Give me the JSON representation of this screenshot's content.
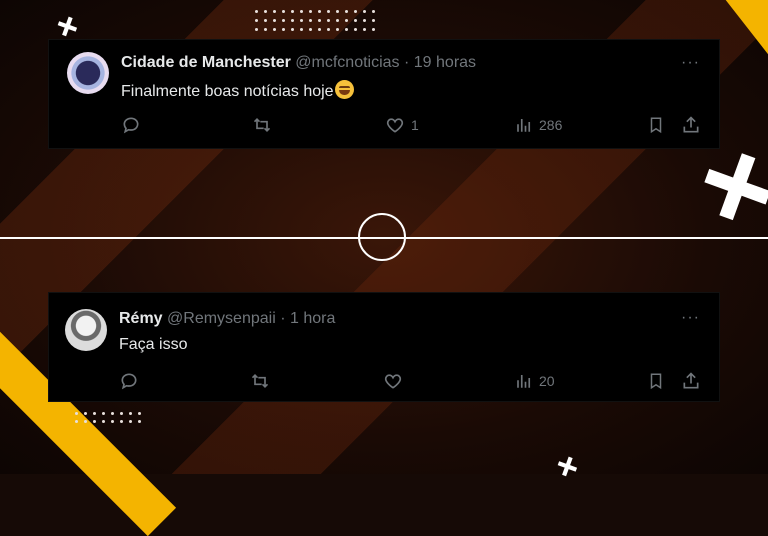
{
  "tweets": [
    {
      "name": "Cidade de Manchester",
      "handle": "@mcfcnoticias",
      "separator": "·",
      "time": "19 horas",
      "text": "Finalmente boas notícias hoje",
      "emoji_icon": "grinning-sweat-emoji",
      "reply_count": "",
      "retweet_count": "",
      "like_count": "1",
      "view_count": "286",
      "more": "···"
    },
    {
      "name": "Rémy",
      "handle": "@Remysenpaii",
      "separator": "·",
      "time": "1 hora",
      "text": "Faça isso",
      "reply_count": "",
      "retweet_count": "",
      "like_count": "",
      "view_count": "20",
      "more": "···"
    }
  ],
  "icons": [
    "reply-icon",
    "retweet-icon",
    "like-icon",
    "views-icon",
    "bookmark-icon",
    "share-icon"
  ],
  "colors": {
    "accent_yellow": "#f4b400",
    "card_bg": "#000000",
    "muted_text": "#71767b",
    "primary_text": "#e7e9ea",
    "background": "#160a06"
  }
}
